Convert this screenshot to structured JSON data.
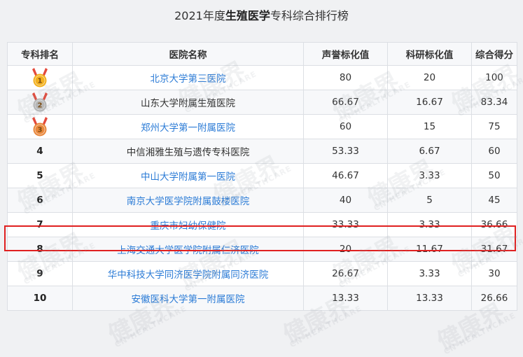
{
  "title": {
    "prefix": "2021年度",
    "bold": "生殖医学",
    "suffix": "专科综合排行榜"
  },
  "headers": [
    "专科排名",
    "医院名称",
    "声誉标化值",
    "科研标化值",
    "综合得分"
  ],
  "rows": [
    {
      "rank": "1",
      "medal": "gold",
      "name": "北京大学第三医院",
      "link": true,
      "reputation": "80",
      "research": "20",
      "total": "100"
    },
    {
      "rank": "2",
      "medal": "silver",
      "name": "山东大学附属生殖医院",
      "link": false,
      "reputation": "66.67",
      "research": "16.67",
      "total": "83.34"
    },
    {
      "rank": "3",
      "medal": "bronze",
      "name": "郑州大学第一附属医院",
      "link": true,
      "reputation": "60",
      "research": "15",
      "total": "75"
    },
    {
      "rank": "4",
      "medal": "",
      "name": "中信湘雅生殖与遗传专科医院",
      "link": false,
      "reputation": "53.33",
      "research": "6.67",
      "total": "60"
    },
    {
      "rank": "5",
      "medal": "",
      "name": "中山大学附属第一医院",
      "link": true,
      "reputation": "46.67",
      "research": "3.33",
      "total": "50"
    },
    {
      "rank": "6",
      "medal": "",
      "name": "南京大学医学院附属鼓楼医院",
      "link": true,
      "reputation": "40",
      "research": "5",
      "total": "45"
    },
    {
      "rank": "7",
      "medal": "",
      "name": "重庆市妇幼保健院",
      "link": true,
      "reputation": "33.33",
      "research": "3.33",
      "total": "36.66"
    },
    {
      "rank": "8",
      "medal": "",
      "name": "上海交通大学医学院附属仁济医院",
      "link": true,
      "reputation": "20",
      "research": "11.67",
      "total": "31.67"
    },
    {
      "rank": "9",
      "medal": "",
      "name": "华中科技大学同济医学院附属同济医院",
      "link": true,
      "reputation": "26.67",
      "research": "3.33",
      "total": "30"
    },
    {
      "rank": "10",
      "medal": "",
      "name": "安徽医科大学第一附属医院",
      "link": true,
      "reputation": "13.33",
      "research": "13.33",
      "total": "26.66"
    }
  ],
  "medal_colors": {
    "gold": "#f2b01e",
    "silver": "#b9b9b9",
    "bronze": "#e8873c"
  },
  "highlight_color": "#e02020",
  "link_color": "#2b7bd6",
  "watermark": {
    "cn": "健康界",
    "en": "CN-HEALTHCARE"
  }
}
